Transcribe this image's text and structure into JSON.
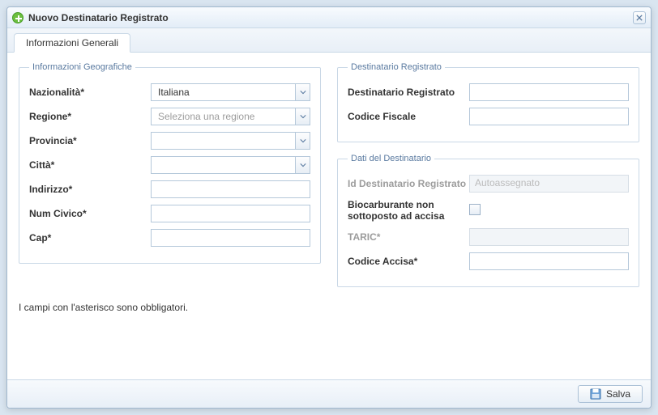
{
  "window": {
    "title": "Nuovo Destinatario Registrato"
  },
  "tabs": [
    {
      "label": "Informazioni Generali"
    }
  ],
  "geo": {
    "legend": "Informazioni Geografiche",
    "nazionalita": {
      "label": "Nazionalità*",
      "value": "Italiana"
    },
    "regione": {
      "label": "Regione*",
      "placeholder": "Seleziona una regione"
    },
    "provincia": {
      "label": "Provincia*",
      "value": ""
    },
    "citta": {
      "label": "Città*",
      "value": ""
    },
    "indirizzo": {
      "label": "Indirizzo*",
      "value": ""
    },
    "civico": {
      "label": "Num Civico*",
      "value": ""
    },
    "cap": {
      "label": "Cap*",
      "value": ""
    }
  },
  "destReg": {
    "legend": "Destinatario Registrato",
    "destinatario": {
      "label": "Destinatario Registrato",
      "value": ""
    },
    "codiceFiscale": {
      "label": "Codice Fiscale",
      "value": ""
    }
  },
  "dati": {
    "legend": "Dati del Destinatario",
    "id": {
      "label": "Id Destinatario Registrato",
      "placeholder": "Autoassegnato"
    },
    "bio": {
      "label": "Biocarburante non sottoposto ad accisa",
      "checked": false
    },
    "taric": {
      "label": "TARIC*",
      "value": ""
    },
    "accisa": {
      "label": "Codice Accisa*",
      "value": ""
    }
  },
  "footnote": "I campi con l'asterisco sono obbligatori.",
  "buttons": {
    "save": "Salva"
  }
}
